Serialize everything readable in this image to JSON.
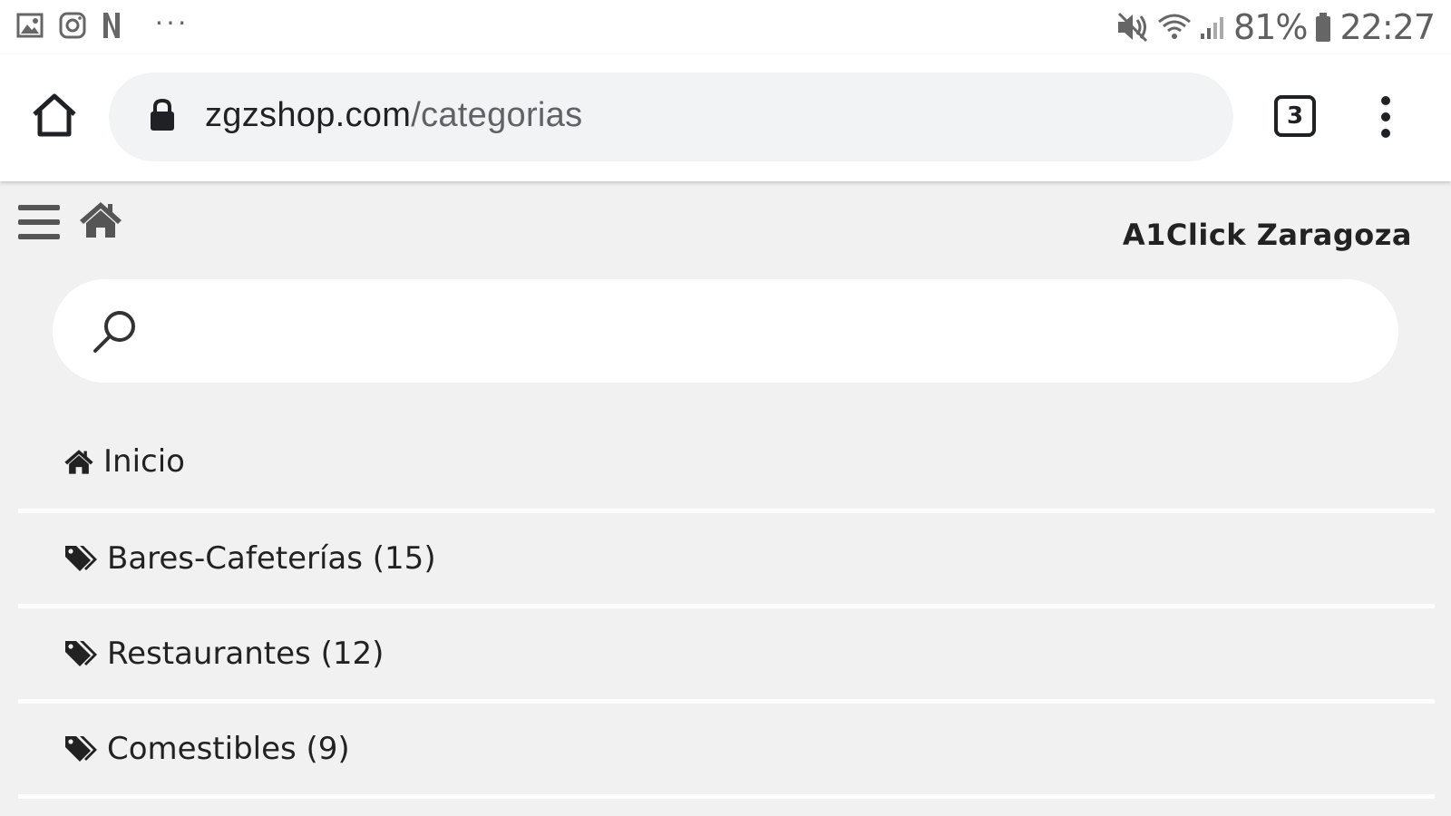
{
  "status_bar": {
    "battery": "81%",
    "time": "22:27",
    "notification_more": "···",
    "notification_icons": [
      "gallery-icon",
      "instagram-icon",
      "netflix-icon"
    ],
    "system_icons": [
      "mute-icon",
      "wifi-icon",
      "signal-icon",
      "battery-icon"
    ]
  },
  "browser": {
    "url_domain": "zgzshop.com",
    "url_path": "/categorias",
    "tab_count": "3",
    "icons": [
      "home-icon",
      "lock-icon",
      "tabs-icon",
      "more-vert-icon"
    ]
  },
  "header": {
    "brand": "A1Click Zaragoza",
    "icons": [
      "hamburger-icon",
      "house-icon"
    ]
  },
  "search": {
    "placeholder": "",
    "value": ""
  },
  "categories": [
    {
      "label": "Inicio",
      "icon": "home-icon"
    },
    {
      "label": "Bares-Cafeterías (15)",
      "icon": "tags-icon"
    },
    {
      "label": "Restaurantes (12)",
      "icon": "tags-icon"
    },
    {
      "label": "Comestibles (9)",
      "icon": "tags-icon"
    }
  ],
  "colors": {
    "page_bg": "#f1f1f1",
    "toolbar_bg": "#ffffff",
    "url_pill_bg": "#f1f3f4",
    "text": "#222222"
  }
}
